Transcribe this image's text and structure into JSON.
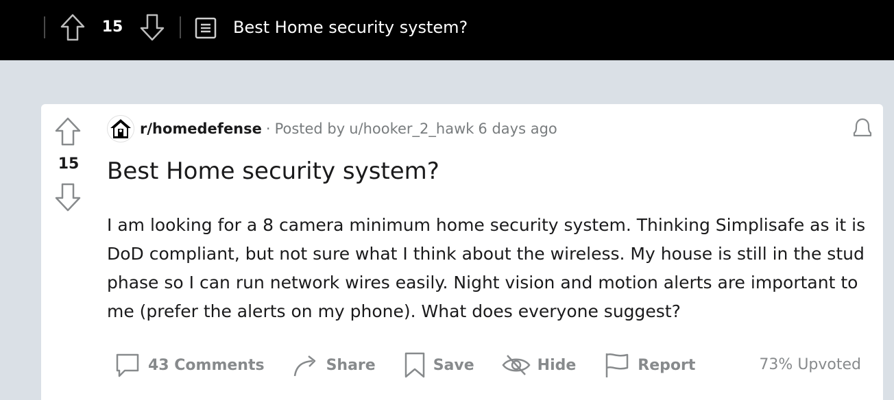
{
  "topbar": {
    "score": "15",
    "title": "Best Home security system?"
  },
  "post": {
    "score": "15",
    "subreddit": "r/homedefense",
    "separator": "·",
    "posted_by_prefix": "Posted by",
    "author": "u/hooker_2_hawk",
    "time": "6 days ago",
    "title": "Best Home security system?",
    "body": "I am looking for a 8 camera minimum home security system. Thinking Simplisafe as it is DoD compliant, but not sure what I think about the wireless. My house is still in the stud phase so I can run network wires easily. Night vision and motion alerts are important to me (prefer the alerts on my phone). What does everyone suggest?"
  },
  "actions": {
    "comments": "43 Comments",
    "share": "Share",
    "save": "Save",
    "hide": "Hide",
    "report": "Report"
  },
  "upvoted": "73% Upvoted",
  "icons": {
    "upvote": "up-arrow-icon",
    "downvote": "down-arrow-icon",
    "post_type": "text-post-icon",
    "subreddit": "house-icon",
    "notify": "bell-icon",
    "comments": "comment-bubble-icon",
    "share": "share-arrow-icon",
    "save": "bookmark-icon",
    "hide": "eye-slash-icon",
    "report": "flag-icon"
  },
  "colors": {
    "background": "#dae0e6",
    "topbar": "#000000",
    "card": "#ffffff",
    "muted": "#878a8c",
    "text": "#1a1a1b"
  }
}
